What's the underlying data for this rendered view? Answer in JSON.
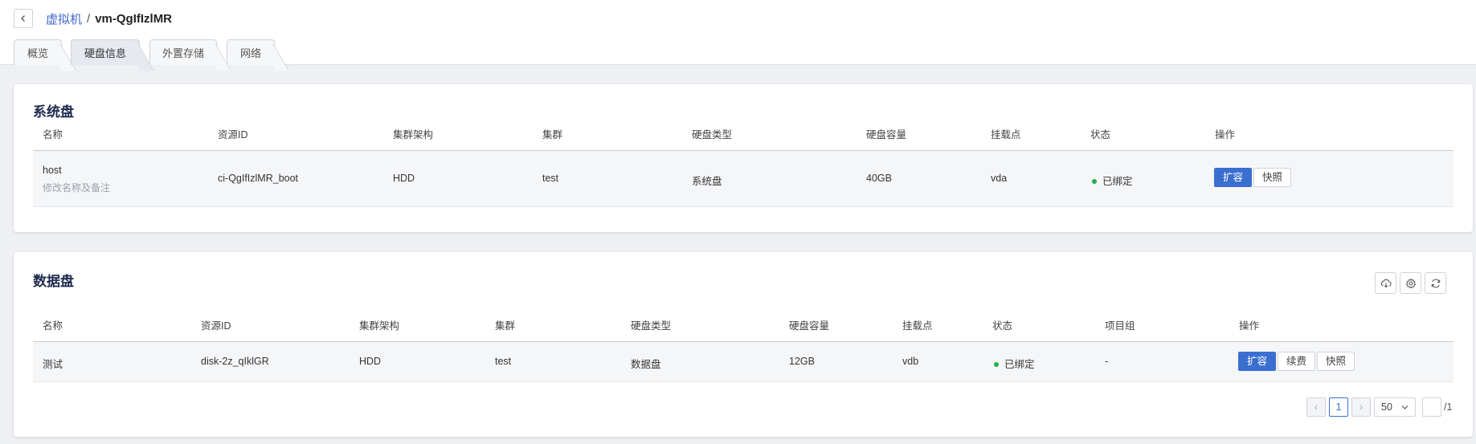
{
  "breadcrumb": {
    "parent": "虚拟机",
    "separator": "/",
    "current": "vm-QgIfIzlMR"
  },
  "tabs": [
    {
      "label": "概览",
      "active": false
    },
    {
      "label": "硬盘信息",
      "active": true
    },
    {
      "label": "外置存储",
      "active": false
    },
    {
      "label": "网络",
      "active": false
    }
  ],
  "system_disk": {
    "title": "系统盘",
    "columns": [
      "名称",
      "资源ID",
      "集群架构",
      "集群",
      "硬盘类型",
      "硬盘容量",
      "挂载点",
      "状态",
      "操作"
    ],
    "row": {
      "name": "host",
      "remark": "修改名称及备注",
      "resource_id": "ci-QgIfIzlMR_boot",
      "arch": "HDD",
      "cluster": "test",
      "disk_type": "系统盘",
      "capacity": "40GB",
      "mount": "vda",
      "status": "已绑定",
      "actions": [
        "扩容",
        "快照"
      ]
    }
  },
  "data_disk": {
    "title": "数据盘",
    "toolbar_icons": [
      "cloud-download-icon",
      "gear-icon",
      "refresh-icon"
    ],
    "columns": [
      "名称",
      "资源ID",
      "集群架构",
      "集群",
      "硬盘类型",
      "硬盘容量",
      "挂载点",
      "状态",
      "项目组",
      "操作"
    ],
    "row": {
      "name": "测试",
      "resource_id": "disk-2z_qIklGR",
      "arch": "HDD",
      "cluster": "test",
      "disk_type": "数据盘",
      "capacity": "12GB",
      "mount": "vdb",
      "status": "已绑定",
      "project_group": "-",
      "actions": [
        "扩容",
        "续费",
        "快照"
      ]
    },
    "pagination": {
      "prev": "‹",
      "current_page": "1",
      "next": "›",
      "page_size": "50",
      "page_input": "",
      "total_pages": "/1"
    }
  },
  "colors": {
    "primary": "#3a6fd0",
    "status_green": "#1bb34a",
    "title": "#1e2b4f",
    "link": "#3f67c8"
  }
}
